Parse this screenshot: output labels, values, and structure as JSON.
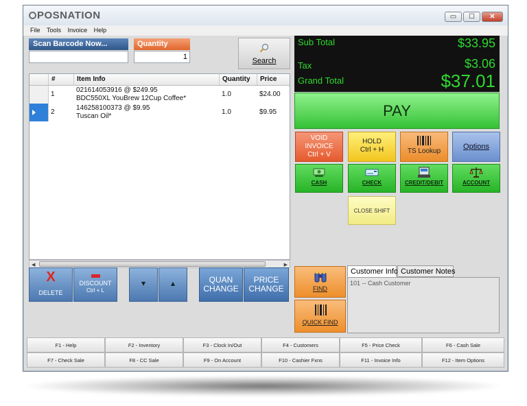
{
  "app": {
    "logo": "POSNATION"
  },
  "window_buttons": {
    "minimize": "▭",
    "maximize": "☐",
    "close": "✕"
  },
  "menu": [
    "File",
    "Tools",
    "Invoice",
    "Help"
  ],
  "scan": {
    "label": "Scan Barcode Now...",
    "value": ""
  },
  "quantity": {
    "label": "Quantity",
    "value": "1"
  },
  "search": {
    "label": "Search",
    "icon": "magnifier-icon"
  },
  "grid": {
    "columns": [
      "#",
      "Item Info",
      "Quantity",
      "Price"
    ],
    "rows": [
      {
        "num": "1",
        "line1": "021614053916 @  $249.95",
        "line2": "BDC550XL YouBrew  12Cup Coffee*",
        "qty": "1.0",
        "price": "$24.00",
        "selected": false
      },
      {
        "num": "2",
        "line1": "146258100373 @  $9.95",
        "line2": "Tuscan Oil*",
        "qty": "1.0",
        "price": "$9.95",
        "selected": true
      }
    ]
  },
  "left_buttons": {
    "delete": "DELETE",
    "delete_icon": "X",
    "discount_line1": "DISCOUNT",
    "discount_line2": "Ctrl + L",
    "down_arrow": "▾",
    "up_arrow": "▴",
    "quan_line1": "QUAN",
    "quan_line2": "CHANGE",
    "price_line1": "PRICE",
    "price_line2": "CHANGE"
  },
  "totals": {
    "sub_total_label": "Sub Total",
    "sub_total": "$33.95",
    "tax_label": "Tax",
    "tax": "$3.06",
    "grand_total_label": "Grand Total",
    "grand_total": "$37.01"
  },
  "pay": "PAY",
  "actions": {
    "void_line1": "VOID",
    "void_line2": "INVOICE",
    "void_line3": "Ctrl + V",
    "hold_line1": "HOLD",
    "hold_line2": "Ctrl + H",
    "ts_lookup": "TS Lookup",
    "options": "Options"
  },
  "payments": {
    "cash": "CASH",
    "check": "CHECK",
    "credit": "CREDIT/DEBIT",
    "account": "ACCOUNT"
  },
  "close_shift": "CLOSE SHIFT",
  "find": "FIND",
  "quick_find": "QUICK FIND",
  "customer_tabs": [
    "Customer Info",
    "Customer Notes"
  ],
  "customer_info": "101 -- Cash Customer",
  "function_keys": [
    "F1 - Help",
    "F2 - Inventory",
    "F3 - Clock In/Out",
    "F4 - Customers",
    "F5 - Price Check",
    "F6 - Cash Sale",
    "F7 - Check Sale",
    "F8 - CC Sale",
    "F9 - On Account",
    "F10 - Cashier Fxns",
    "F11 - Invoice Info",
    "F12 - Item Options"
  ],
  "colors": {
    "total_green": "#2fd92f",
    "pay_green": "#35c135",
    "accent_blue": "#3f6eaa",
    "accent_orange": "#ee8f2b"
  }
}
